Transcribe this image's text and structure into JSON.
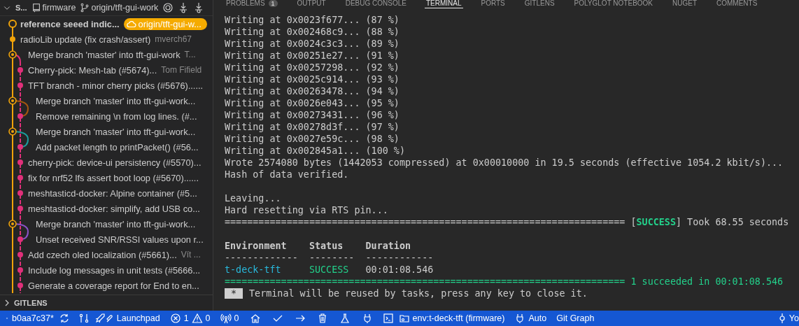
{
  "scm_header": {
    "title": "S...",
    "repo": "firmware",
    "branch": "origin/tft-gui-work"
  },
  "commits": [
    {
      "kind": "head",
      "message": "reference seeed indic...",
      "badge": "origin/tft-gui-w..."
    },
    {
      "kind": "main",
      "message": "radioLib update (fix crash/assert)",
      "author": "mverch67"
    },
    {
      "kind": "merge-start",
      "message": "Merge branch 'master' into tft-gui-work",
      "author": "T..."
    },
    {
      "kind": "side",
      "message": "Cherry-pick: Mesh-tab (#5674)...",
      "author": "Tom Fifield"
    },
    {
      "kind": "side",
      "message": "TFT branch - minor cherry picks (#5676)......"
    },
    {
      "kind": "merge",
      "message": "Merge branch 'master' into tft-gui-work...",
      "color": "#a3560f"
    },
    {
      "kind": "side-fork",
      "message": "Remove remaining \\n from log lines. (#...",
      "color": "#a3560f"
    },
    {
      "kind": "merge",
      "message": "Merge branch 'master' into tft-gui-work...",
      "color": "#1b9c9c"
    },
    {
      "kind": "side-fork",
      "message": "Add packet length to printPacket() (#56...",
      "color": "#1b9c9c"
    },
    {
      "kind": "side",
      "message": "cherry-pick: device-ui persistency (#5570)..."
    },
    {
      "kind": "side",
      "message": "fix for nrf52 lfs assert boot loop (#5670)......"
    },
    {
      "kind": "side",
      "message": "meshtasticd-docker: Alpine container (#5..."
    },
    {
      "kind": "side",
      "message": "meshtasticd-docker: simplify, add USB co..."
    },
    {
      "kind": "merge",
      "message": "Merge branch 'master' into tft-gui-work...",
      "color": "#8a52c8"
    },
    {
      "kind": "side-fork",
      "message": "Unset received SNR/RSSI values upon r...",
      "color": "#8a52c8"
    },
    {
      "kind": "side",
      "message": "Add czech oled localization (#5661)...",
      "author": "Vít ..."
    },
    {
      "kind": "side",
      "message": "Include log messages in unit tests (#5666..."
    },
    {
      "kind": "side",
      "message": "Generate a coverage report for End to en..."
    }
  ],
  "gitlens_section": {
    "title": "GITLENS",
    "expanded": false
  },
  "panel_tabs": [
    {
      "label": "PROBLEMS",
      "badge": "1",
      "selected": false
    },
    {
      "label": "OUTPUT",
      "selected": false
    },
    {
      "label": "DEBUG CONSOLE",
      "selected": false
    },
    {
      "label": "TERMINAL",
      "selected": true
    },
    {
      "label": "PORTS",
      "selected": false
    },
    {
      "label": "GITLENS",
      "selected": false
    },
    {
      "label": "POLYGLOT NOTEBOOK",
      "selected": false
    },
    {
      "label": "NUGET",
      "selected": false
    },
    {
      "label": "COMMENTS",
      "selected": false
    }
  ],
  "terminal": {
    "lines": [
      {
        "kind": "text",
        "text": "Writing at 0x0023f677... (87 %)"
      },
      {
        "kind": "text",
        "text": "Writing at 0x002468c9... (88 %)"
      },
      {
        "kind": "text",
        "text": "Writing at 0x0024c3c3... (89 %)"
      },
      {
        "kind": "text",
        "text": "Writing at 0x00251e27... (91 %)"
      },
      {
        "kind": "text",
        "text": "Writing at 0x00257298... (92 %)"
      },
      {
        "kind": "text",
        "text": "Writing at 0x0025c914... (93 %)"
      },
      {
        "kind": "text",
        "text": "Writing at 0x00263478... (94 %)"
      },
      {
        "kind": "text",
        "text": "Writing at 0x0026e043... (95 %)"
      },
      {
        "kind": "text",
        "text": "Writing at 0x00273431... (96 %)"
      },
      {
        "kind": "text",
        "text": "Writing at 0x00278d3f... (97 %)"
      },
      {
        "kind": "text",
        "text": "Writing at 0x0027e59c... (98 %)"
      },
      {
        "kind": "text",
        "text": "Writing at 0x002845a1... (100 %)"
      },
      {
        "kind": "text",
        "text": "Wrote 2574080 bytes (1442053 compressed) at 0x00010000 in 19.5 seconds (effective 1054.2 kbit/s)..."
      },
      {
        "kind": "text",
        "text": "Hash of data verified."
      },
      {
        "kind": "blank"
      },
      {
        "kind": "text",
        "text": "Leaving..."
      },
      {
        "kind": "text",
        "text": "Hard resetting via RTS pin..."
      },
      {
        "kind": "result",
        "rule": "=======================================================================",
        "prefix": "[",
        "status": "SUCCESS",
        "suffix": "] Took 68.55 seconds"
      },
      {
        "kind": "blank"
      },
      {
        "kind": "table",
        "columns": [
          "Environment",
          "Status",
          "Duration"
        ],
        "dashes": [
          "-------------",
          "--------",
          "------------"
        ],
        "rows": [
          [
            "t-deck-tft",
            "SUCCESS",
            "00:01:08.546"
          ]
        ]
      },
      {
        "kind": "summary",
        "rule": "=======================================================================",
        "text": "1 succeeded in 00:01:08.546"
      },
      {
        "kind": "notice",
        "key": "*",
        "text": "Terminal will be reused by tasks, press any key to close it."
      }
    ]
  },
  "status_bar": {
    "branch": "b0aa7c37*",
    "launchpad": "Launchpad",
    "errors": "1",
    "warnings": "0",
    "ports": "0",
    "env": "env:t-deck-tft (firmware)",
    "auto": "Auto",
    "git_graph": "Git Graph",
    "right": "Yo"
  }
}
